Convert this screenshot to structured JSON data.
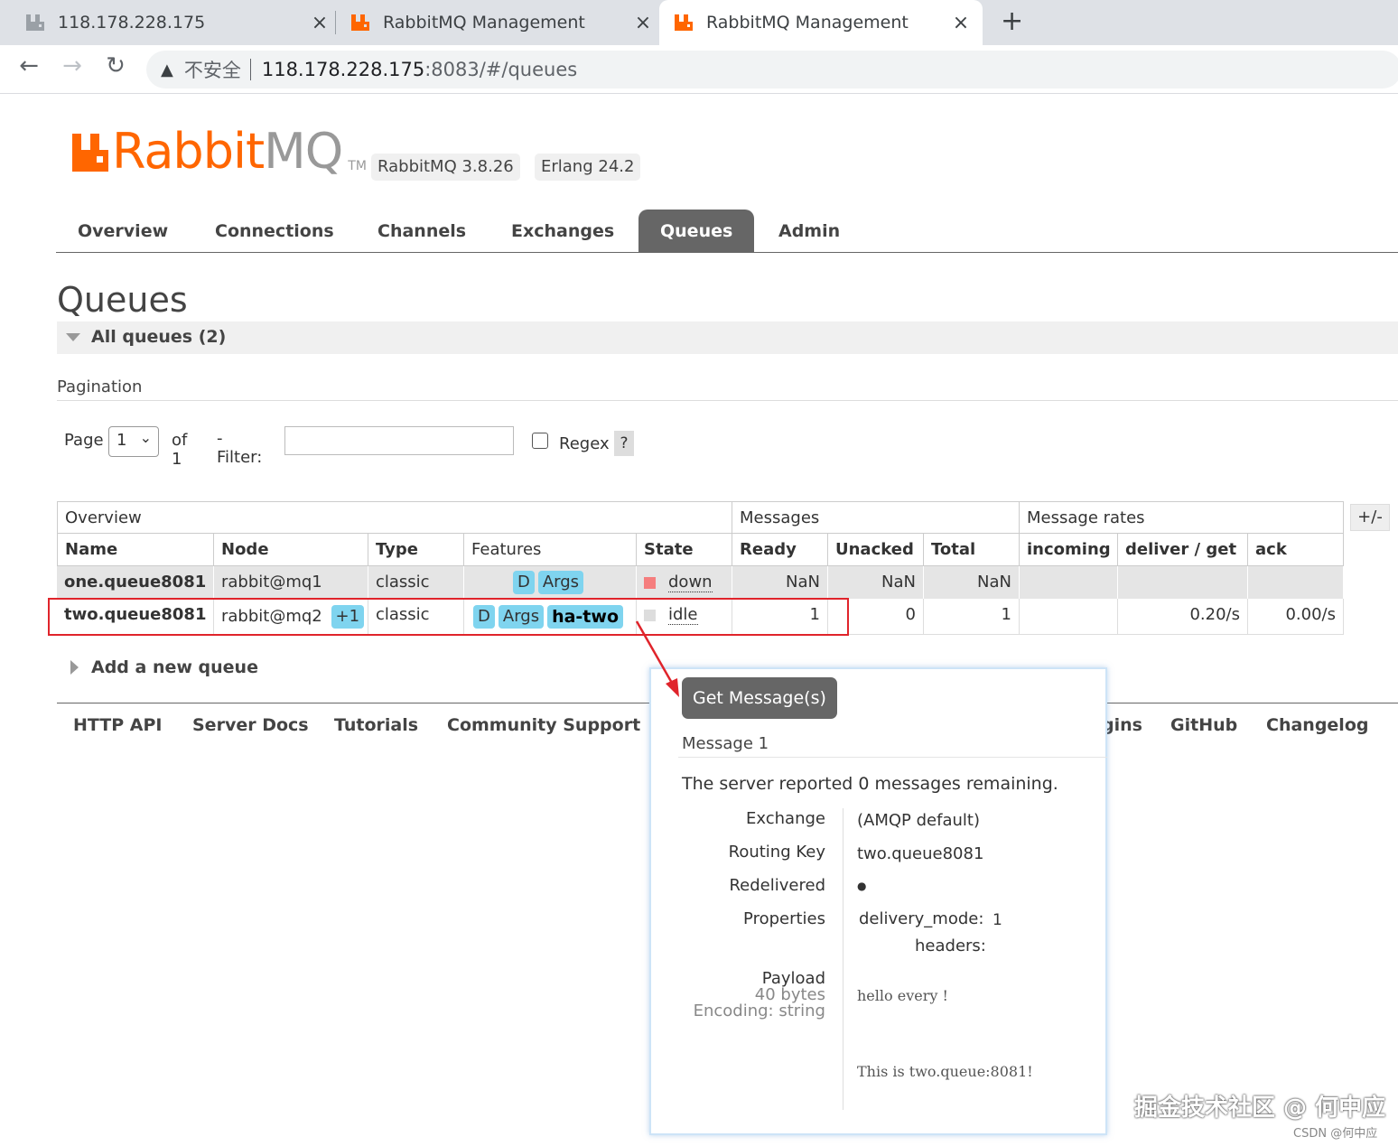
{
  "browser": {
    "tabs": [
      {
        "title": "118.178.228.175"
      },
      {
        "title": "RabbitMQ Management"
      },
      {
        "title": "RabbitMQ Management"
      }
    ],
    "tab_close": "×",
    "new_tab": "+",
    "nav": {
      "back": "←",
      "forward": "→",
      "reload": "↻"
    },
    "address": {
      "warning": "▲",
      "insecure": "不安全",
      "host": "118.178.228.175",
      "path": ":8083/#/queues"
    }
  },
  "header": {
    "logo_rabbit": "Rabbit",
    "logo_mq": "MQ",
    "logo_tm": "TM",
    "rabbit_version": "RabbitMQ 3.8.26",
    "erlang_version": "Erlang 24.2"
  },
  "menu": {
    "items": [
      "Overview",
      "Connections",
      "Channels",
      "Exchanges",
      "Queues",
      "Admin"
    ],
    "active": "Queues"
  },
  "page": {
    "title": "Queues",
    "section": "All queues (2)",
    "pagination_title": "Pagination",
    "page_label": "Page",
    "page_value": "1",
    "of_label": "of 1",
    "filter_label": "- Filter:",
    "filter_value": "",
    "regex_label": "Regex",
    "help": "?"
  },
  "table": {
    "groups": [
      "Overview",
      "Messages",
      "Message rates"
    ],
    "toggle": "+/-",
    "columns": [
      "Name",
      "Node",
      "Type",
      "Features",
      "State",
      "Ready",
      "Unacked",
      "Total",
      "incoming",
      "deliver / get",
      "ack"
    ],
    "rows": [
      {
        "name": "one.queue8081",
        "node": "rabbit@mq1",
        "node_extra": "",
        "type": "classic",
        "features": [
          "D",
          "Args"
        ],
        "policy": "",
        "state": "down",
        "state_color": "#f57e7e",
        "ready": "NaN",
        "unacked": "NaN",
        "total": "NaN",
        "incoming": "",
        "deliver_get": "",
        "ack": ""
      },
      {
        "name": "two.queue8081",
        "node": "rabbit@mq2",
        "node_extra": "+1",
        "type": "classic",
        "features": [
          "D",
          "Args"
        ],
        "policy": "ha-two",
        "state": "idle",
        "state_color": "#dddddd",
        "ready": "1",
        "unacked": "0",
        "total": "1",
        "incoming": "",
        "deliver_get": "0.20/s",
        "ack": "0.00/s"
      }
    ]
  },
  "add_queue": "Add a new queue",
  "footer": {
    "links": [
      "HTTP API",
      "Server Docs",
      "Tutorials",
      "Community Support",
      "gins",
      "GitHub",
      "Changelog"
    ]
  },
  "popup": {
    "button": "Get Message(s)",
    "message_title": "Message 1",
    "remaining_prefix": "The server reported ",
    "remaining_count": "0",
    "remaining_suffix": " messages remaining.",
    "labels": {
      "exchange": "Exchange",
      "routing_key": "Routing Key",
      "redelivered": "Redelivered",
      "properties": "Properties",
      "payload": "Payload",
      "payload_size": "40 bytes",
      "encoding": "Encoding: string"
    },
    "values": {
      "exchange": "(AMQP default)",
      "routing_key": "two.queue8081",
      "redelivered": "●",
      "delivery_mode_label": "delivery_mode:",
      "delivery_mode_value": "1",
      "headers_label": "headers:",
      "payload_line1": "hello every !",
      "payload_line2": "This is two.queue:8081!"
    }
  },
  "watermark": {
    "main": "掘金技术社区 @ 何中应",
    "small": "CSDN @何中应"
  },
  "colors": {
    "brand": "#ff6600",
    "menu_active": "#666666",
    "tag": "#7fd4ef",
    "highlight": "#e0242b"
  }
}
